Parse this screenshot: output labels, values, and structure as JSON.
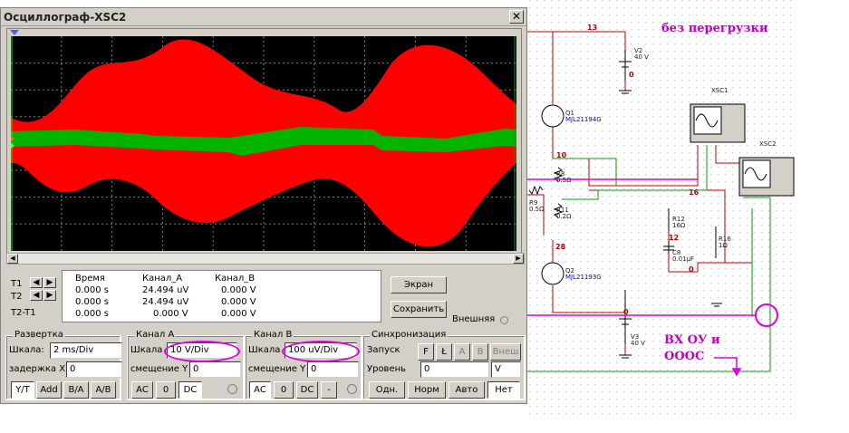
{
  "notes": {
    "top": "без перегрузки",
    "bottom_line1": "ВХ ОУ и",
    "bottom_line2": "ОООС"
  },
  "schematic": {
    "net_labels": [
      "13",
      "0",
      "10",
      "16",
      "12",
      "28",
      "0",
      "0"
    ],
    "components": {
      "xsc1": "XSC1",
      "xsc2": "XSC2",
      "v2": "V2",
      "v2_val": "40 V",
      "v3": "V3",
      "v3_val": "40 V",
      "q1": "Q1",
      "q1_model": "MJL21194G",
      "q2": "Q2",
      "q2_model": "MJL21193G",
      "r8": "R8",
      "r8_val": "0.5Ω",
      "r9": "R9",
      "r9_val": "0.5Ω",
      "r11": "R11",
      "r11_val": "0.2Ω",
      "r12": "R12",
      "r12_val": "16Ω",
      "r16": "R16",
      "r16_val": "1Ω",
      "c8": "C8",
      "c8_val": "0.01µF"
    }
  },
  "window": {
    "title": "Осциллограф-XSC2",
    "close": "✕"
  },
  "readout": {
    "headers": {
      "time": "Время",
      "cha": "Канал_A",
      "chb": "Канал_B"
    },
    "rows": [
      {
        "label": "T1",
        "time": "0.000 s",
        "cha": "24.494 uV",
        "chb": "0.000 V"
      },
      {
        "label": "T2",
        "time": "0.000 s",
        "cha": "24.494 uV",
        "chb": "0.000 V"
      },
      {
        "label": "T2-T1",
        "time": "0.000 s",
        "cha": "0.000 V",
        "chb": "0.000 V"
      }
    ]
  },
  "buttons": {
    "screen": "Экран",
    "save": "Сохранить",
    "external": "Внешняя"
  },
  "timebase": {
    "title": "Развертка",
    "scale_label": "Шкала:",
    "scale_value": "2 ms/Div",
    "delay_label": "задержка X",
    "delay_value": "0",
    "modes": [
      "Y/T",
      "Add",
      "B/A",
      "A/B"
    ]
  },
  "channel_a": {
    "title": "Канал А",
    "scale_label": "Шкала",
    "scale_value": "10  V/Div",
    "offset_label": "смещение Y",
    "offset_value": "0",
    "coupling": [
      "AC",
      "0",
      "DC"
    ]
  },
  "channel_b": {
    "title": "Канал В",
    "scale_label": "Шкала",
    "scale_value": "100 uV/Div",
    "offset_label": "смещение Y",
    "offset_value": "0",
    "coupling": [
      "AC",
      "0",
      "DC",
      "-"
    ]
  },
  "trigger": {
    "title": "Синхронизация",
    "edge_label": "Запуск",
    "edges": [
      "F",
      "Ł",
      "A",
      "B",
      "Внеш"
    ],
    "level_label": "Уровень",
    "level_value": "0",
    "level_unit": "V",
    "modes": [
      "Одн.",
      "Норм",
      "Авто",
      "Нет"
    ]
  },
  "colors": {
    "channel_a": "#ff0000",
    "channel_b": "#00c000",
    "annotation": "#e000e0",
    "screen": "#000000"
  }
}
